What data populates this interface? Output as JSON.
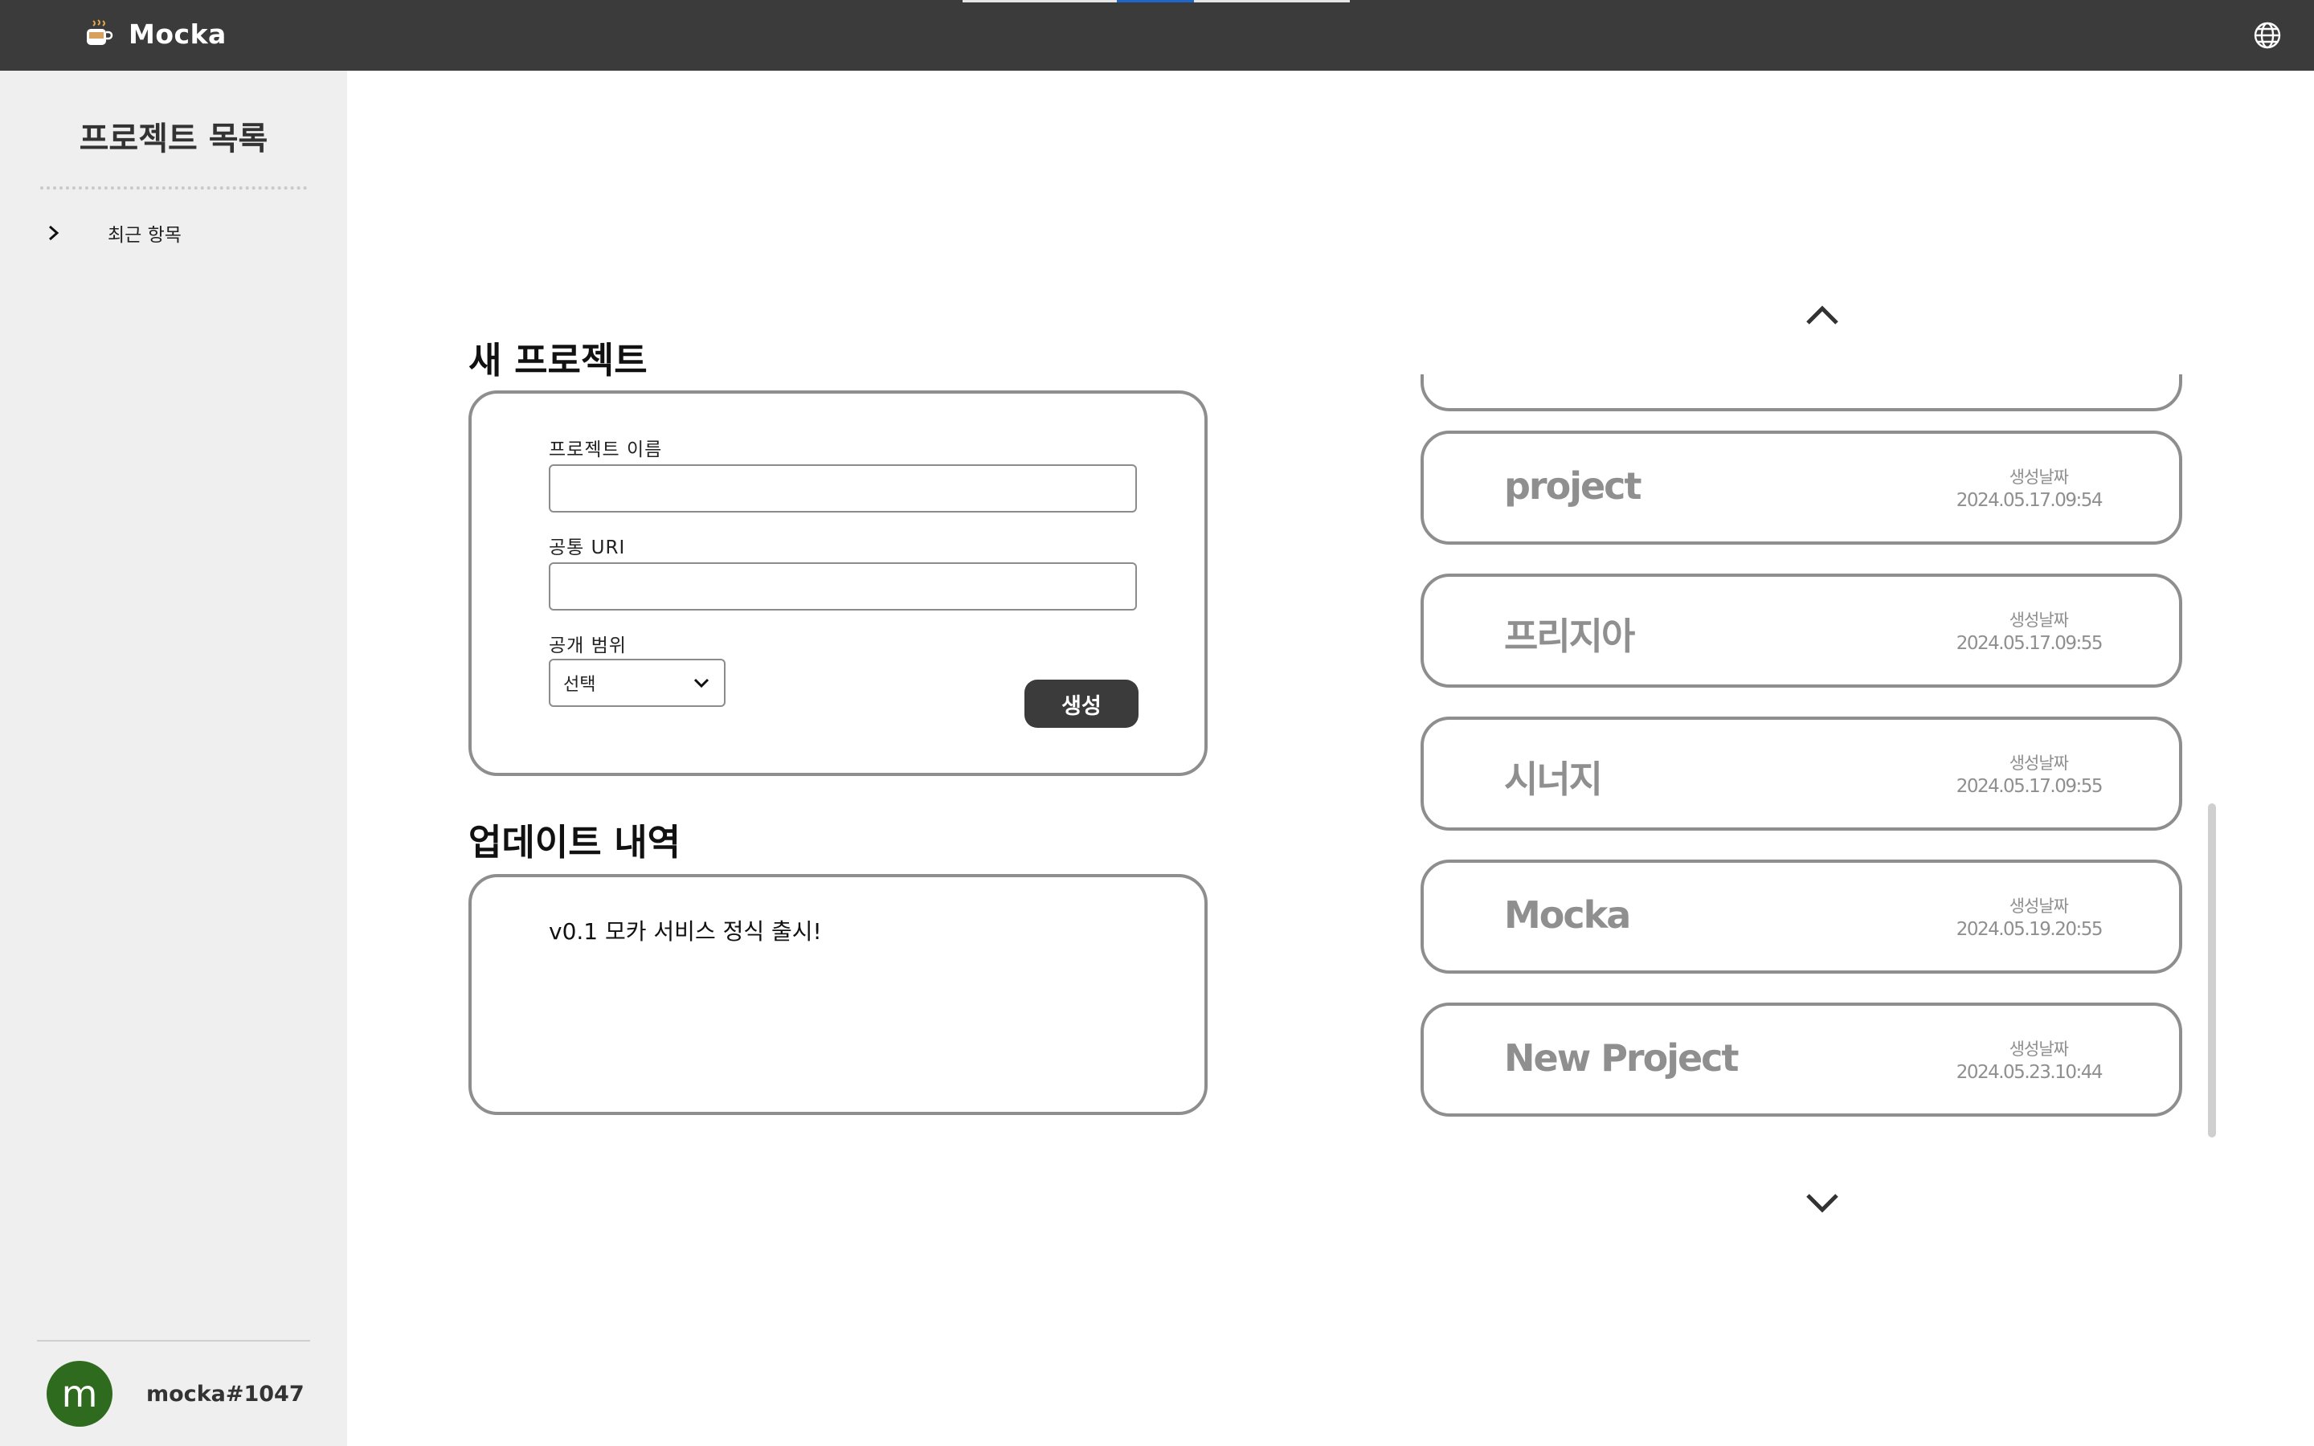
{
  "app": {
    "brand_name": "Mocka",
    "brand_icon": "coffee-cup-icon",
    "language_icon": "globe-icon"
  },
  "sidebar": {
    "title": "프로젝트 목록",
    "recent_label": "최근 항목",
    "user": {
      "avatar_letter": "m",
      "name": "mocka#1047",
      "avatar_color": "#2f6b1f"
    }
  },
  "new_project": {
    "title": "새 프로젝트",
    "name_label": "프로젝트 이름",
    "name_value": "",
    "uri_label": "공통 URI",
    "uri_value": "",
    "scope_label": "공개 범위",
    "scope_selected": "선택",
    "create_label": "생성"
  },
  "updates": {
    "title": "업데이트 내역",
    "items": [
      "v0.1 모카 서비스 정식 출시!"
    ]
  },
  "projects": {
    "date_label": "생성날짜",
    "items": [
      {
        "name": "",
        "date": ""
      },
      {
        "name": "project",
        "date": "2024.05.17.09:54"
      },
      {
        "name": "프리지아",
        "date": "2024.05.17.09:55"
      },
      {
        "name": "시너지",
        "date": "2024.05.17.09:55"
      },
      {
        "name": "Mocka",
        "date": "2024.05.19.20:55"
      },
      {
        "name": "New Project",
        "date": "2024.05.23.10:44"
      }
    ]
  },
  "colors": {
    "topbar": "#3b3b3b",
    "sidebar": "#efefef",
    "accent": "#1f66c6",
    "card_border": "#8e8e8e",
    "muted_text": "#8f8f8f"
  }
}
